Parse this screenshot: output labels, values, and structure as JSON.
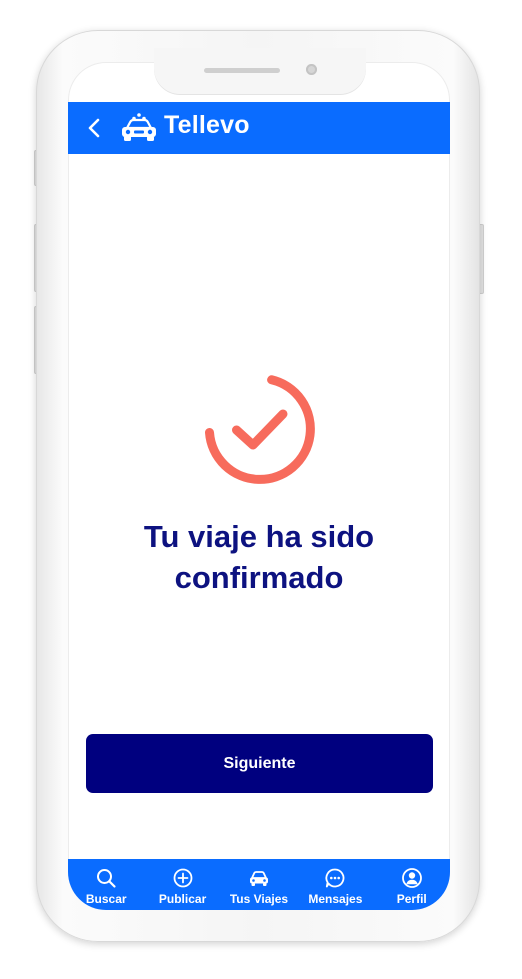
{
  "app": {
    "title": "Tellevo",
    "back_icon": "chevron-left-icon",
    "logo_icon": "taxi-car-icon"
  },
  "confirmation": {
    "status_icon": "check-circle-icon",
    "message_line1": "Tu viaje ha sido",
    "message_line2": "confirmado"
  },
  "actions": {
    "next_label": "Siguiente"
  },
  "bottom_nav": {
    "items": [
      {
        "label": "Buscar",
        "icon": "search-icon"
      },
      {
        "label": "Publicar",
        "icon": "plus-circle-icon"
      },
      {
        "label": "Tus Viajes",
        "icon": "car-icon"
      },
      {
        "label": "Mensajes",
        "icon": "chat-bubble-icon"
      },
      {
        "label": "Perfil",
        "icon": "user-circle-icon"
      }
    ]
  },
  "colors": {
    "primary_blue": "#0a6cff",
    "navy": "#00007f",
    "title_text": "#0d1280",
    "success_coral": "#f76b5c",
    "background": "#ffffff"
  }
}
